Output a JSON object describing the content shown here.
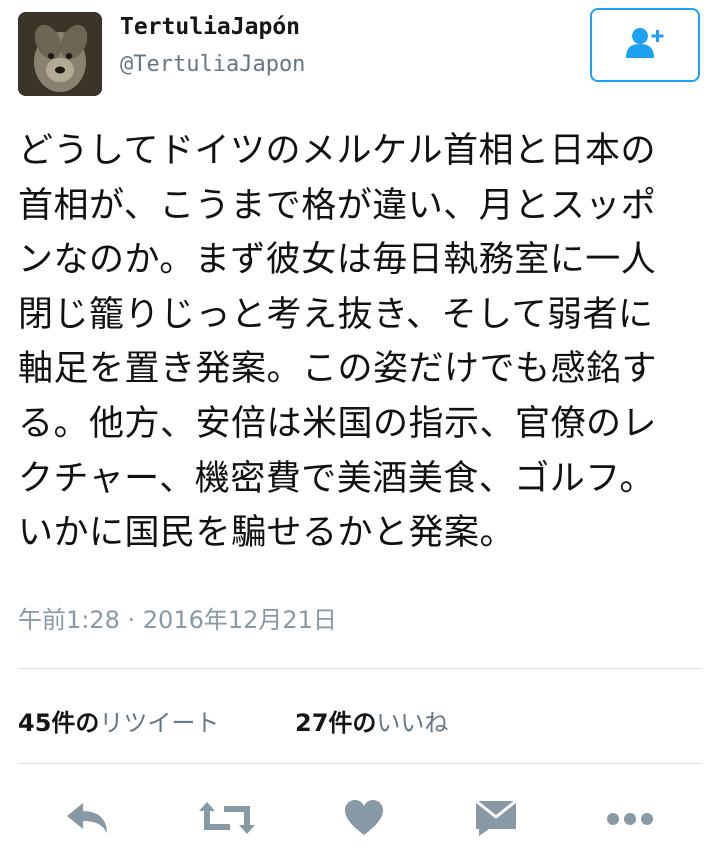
{
  "user": {
    "display_name": "TertuliaJapón",
    "handle": "@TertuliaJapon"
  },
  "tweet": {
    "lines": [
      "どうしてドイツのメルケル首相と日本の",
      "首相が、こうまで格が違い、月とスッポ",
      "ンなのか。まず彼女は毎日執務室に一人",
      "閉じ籠りじっと考え抜き、そして弱者に",
      "軸足を置き発案。この姿だけでも感銘す",
      "る。他方、安倍は米国の指示、官僚のレ",
      "クチャー、機密費で美酒美食、ゴルフ。",
      "いかに国民を騙せるかと発案。"
    ],
    "timestamp": "午前1:28 · 2016年12月21日"
  },
  "stats": {
    "retweets": {
      "count": "45件の",
      "label": "リツイート"
    },
    "likes": {
      "count": "27件の",
      "label": "いいね"
    }
  },
  "icons": {
    "follow": "add-user-icon",
    "reply": "reply-icon",
    "retweet": "retweet-icon",
    "like": "heart-icon",
    "dm": "envelope-icon",
    "more": "more-icon"
  },
  "colors": {
    "accent": "#1da1f2",
    "icon_gray": "#8899a6",
    "secondary_text": "#657786"
  }
}
